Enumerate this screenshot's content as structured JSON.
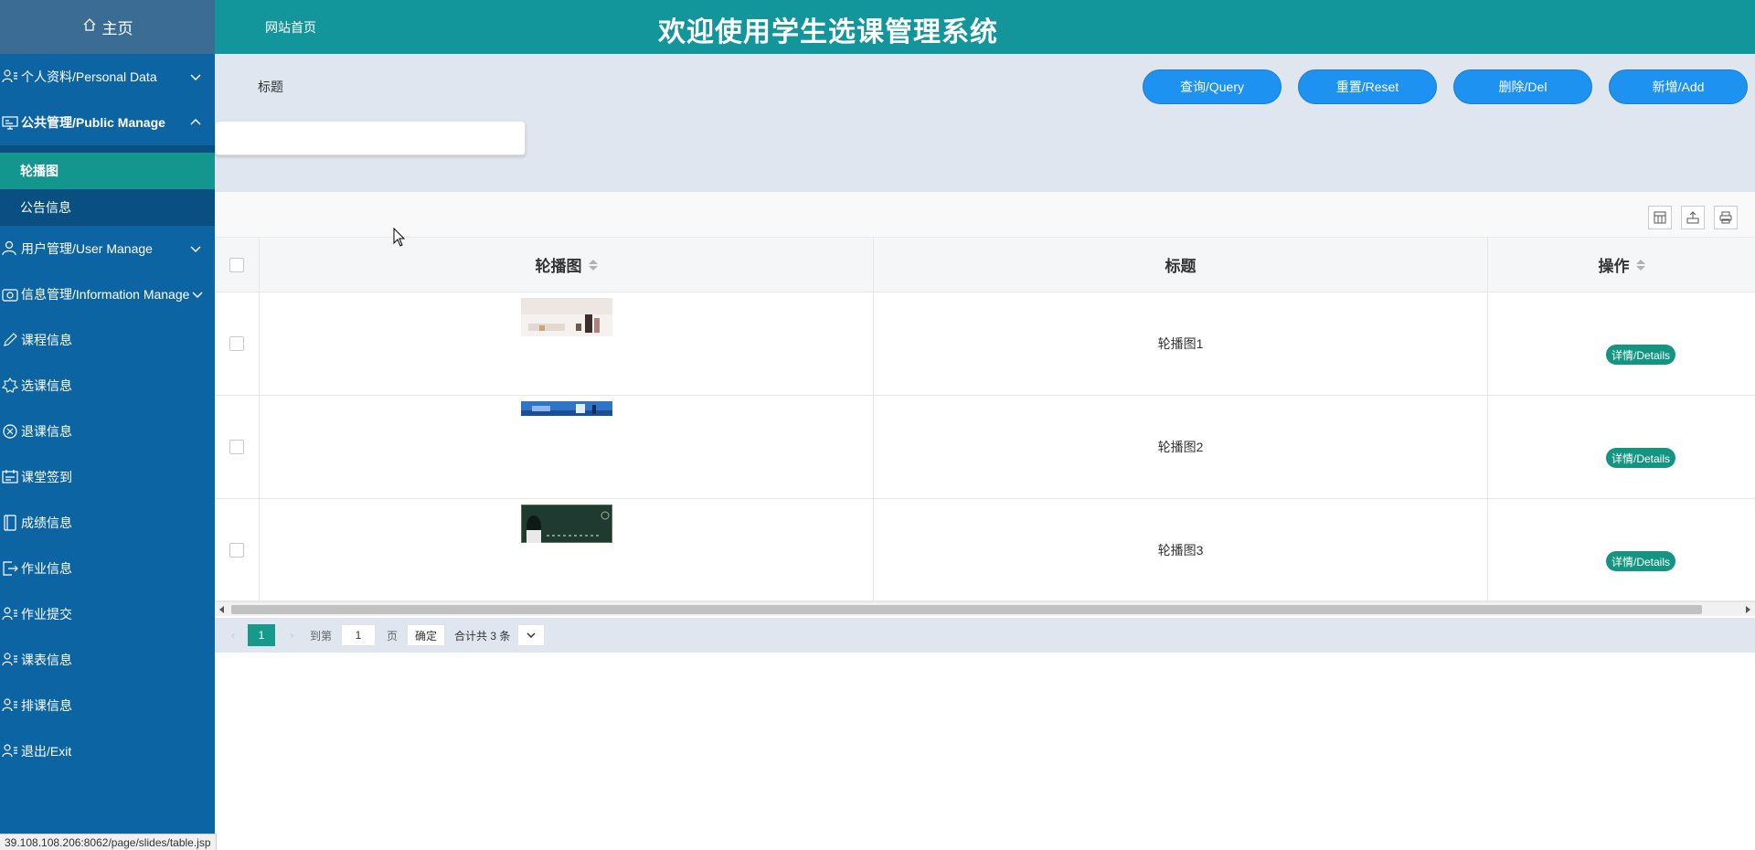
{
  "sidebar": {
    "home_label": "主页",
    "menu": [
      {
        "label": "个人资料/Personal Data",
        "expanded": false
      },
      {
        "label": "公共管理/Public Manage",
        "expanded": true
      },
      {
        "label": "用户管理/User Manage",
        "expanded": false
      },
      {
        "label": "信息管理/Information Manage",
        "expanded": false
      }
    ],
    "submenu": [
      {
        "label": "轮播图",
        "active": true
      },
      {
        "label": "公告信息",
        "active": false
      }
    ],
    "items": [
      {
        "label": "课程信息"
      },
      {
        "label": "选课信息"
      },
      {
        "label": "退课信息"
      },
      {
        "label": "课堂签到"
      },
      {
        "label": "成绩信息"
      },
      {
        "label": "作业信息"
      },
      {
        "label": "作业提交"
      },
      {
        "label": "课表信息"
      },
      {
        "label": "排课信息"
      },
      {
        "label": "退出/Exit"
      }
    ]
  },
  "status_url": "39.108.108.206:8062/page/slides/table.jsp",
  "header": {
    "site_link": "网站首页",
    "title": "欢迎使用学生选课管理系统"
  },
  "search": {
    "label": "标题",
    "value": "",
    "buttons": {
      "query": "查询/Query",
      "reset": "重置/Reset",
      "delete": "删除/Del",
      "add": "新增/Add"
    }
  },
  "table": {
    "columns": [
      "轮播图",
      "标题",
      "操作"
    ],
    "rows": [
      {
        "title": "轮播图1",
        "action": "详情/Details"
      },
      {
        "title": "轮播图2",
        "action": "详情/Details"
      },
      {
        "title": "轮播图3",
        "action": "详情/Details"
      }
    ]
  },
  "pager": {
    "current_page": "1",
    "goto_label": "到第",
    "goto_value": "1",
    "page_unit": "页",
    "confirm": "确定",
    "total": "合计共 3 条"
  },
  "colors": {
    "sidebar": "#0c64a3",
    "header": "#13969b",
    "button": "#1d92f0",
    "active": "#13968d"
  }
}
